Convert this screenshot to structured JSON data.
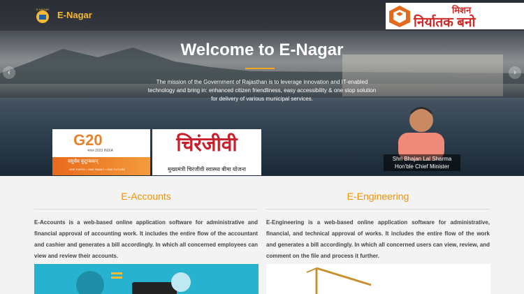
{
  "header": {
    "brand": "E-Nagar",
    "logo_text": "E-NAGAR",
    "mission_badge": {
      "top": "मिशन",
      "main": "निर्यातक बनो"
    }
  },
  "hero": {
    "title": "Welcome to E-Nagar",
    "description": "The mission of the Government of Rajasthan is to leverage innovation and IT-enabled technology and bring in: enhanced citizen friendliness, easy accessibility & one stop solution for delivery of various municipal services.",
    "prev_icon": "chevron-left-icon",
    "next_icon": "chevron-right-icon",
    "accent": "#f5a623"
  },
  "banners": {
    "g20": {
      "logo": "G20",
      "hindi": "भारत 2023 INDIA",
      "theme_hindi": "वसुधैव कुटुम्बकम्",
      "theme": "ONE EARTH • ONE FAMILY • ONE FUTURE"
    },
    "chiranjeevi": {
      "title": "चिरंजीवी",
      "subtitle": "मुख्यमंत्री चिरंजीवी स्वास्थ्य बीमा योजना"
    }
  },
  "cm": {
    "name": "Shri Bhajan Lal Sharma",
    "role": "Hon'ble Chief Minister"
  },
  "sections": [
    {
      "title": "E-Accounts",
      "text": "E-Accounts is a web-based online application software for administrative and financial approval of accounting work. It includes the entire flow of the accountant and cashier and generates a bill accordingly. In which all concerned employees can view and review their accounts."
    },
    {
      "title": "E-Engineering",
      "text": "E-Engineering is a web-based online application software for administrative, financial, and technical approval of works. It includes the entire flow of the work and generates a bill accordingly. In which all concerned users can view, review, and comment on the file and process it further."
    }
  ]
}
